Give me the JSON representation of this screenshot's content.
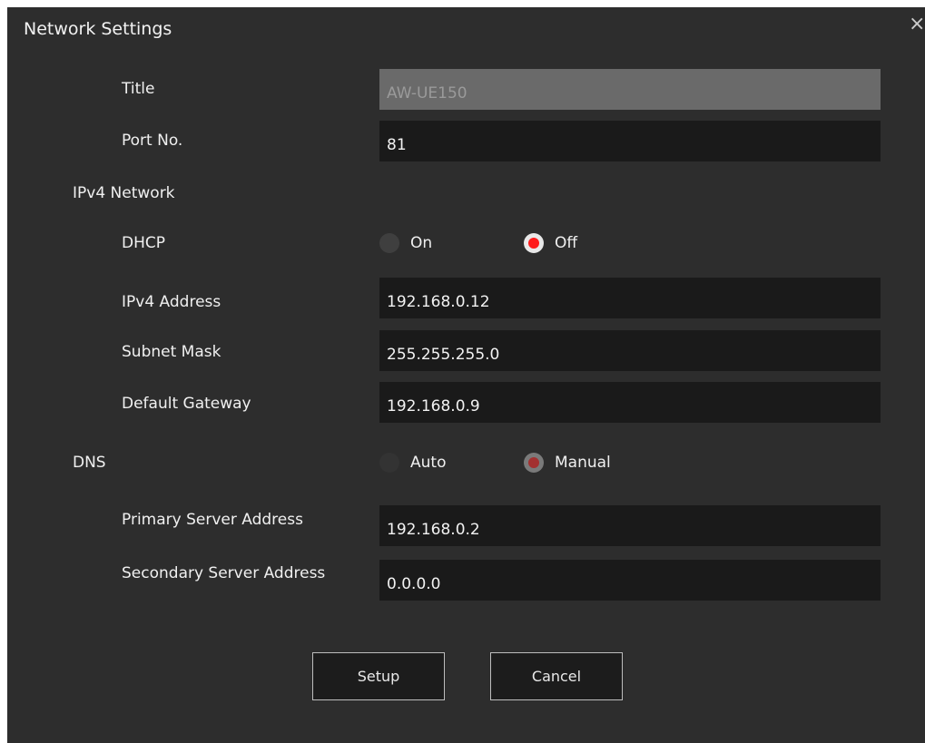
{
  "dialog": {
    "title": "Network Settings",
    "close_glyph": "×"
  },
  "fields": {
    "title": {
      "label": "Title",
      "value": "AW-UE150",
      "disabled": true
    },
    "port": {
      "label": "Port No.",
      "value": "81"
    },
    "ipv4_section": "IPv4 Network",
    "dhcp": {
      "label": "DHCP",
      "options": [
        {
          "label": "On",
          "checked": false
        },
        {
          "label": "Off",
          "checked": true
        }
      ]
    },
    "ipv4_address": {
      "label": "IPv4 Address",
      "value": "192.168.0.12"
    },
    "subnet_mask": {
      "label": "Subnet Mask",
      "value": "255.255.255.0"
    },
    "default_gateway": {
      "label": "Default Gateway",
      "value": "192.168.0.9"
    },
    "dns": {
      "label": "DNS",
      "disabled": true,
      "options": [
        {
          "label": "Auto",
          "checked": false
        },
        {
          "label": "Manual",
          "checked": true
        }
      ]
    },
    "primary_dns": {
      "label": "Primary Server Address",
      "value": "192.168.0.2"
    },
    "secondary_dns": {
      "label": "Secondary Server Address",
      "value": "0.0.0.0"
    }
  },
  "buttons": {
    "setup": "Setup",
    "cancel": "Cancel"
  },
  "colors": {
    "dialog_bg": "#2d2d2d",
    "field_bg": "#1a1a1a",
    "disabled_field_bg": "#6a6a6a",
    "radio_selected": "#ff1a1a"
  }
}
